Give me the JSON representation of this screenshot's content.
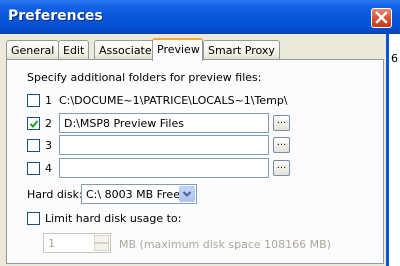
{
  "dialog": {
    "title": "Preferences"
  },
  "tabs": [
    "General",
    "Edit",
    "Associate",
    "Preview",
    "Smart Proxy"
  ],
  "active_tab": "Preview",
  "preview": {
    "intro": "Specify additional folders for preview files:",
    "folders": [
      {
        "index": "1",
        "checked": false,
        "path": "C:\\DOCUME~1\\PATRICE\\LOCALS~1\\Temp\\"
      },
      {
        "index": "2",
        "checked": true,
        "path": "D:\\MSP8 Preview Files",
        "browse": "..."
      },
      {
        "index": "3",
        "checked": false,
        "path": "",
        "browse": "..."
      },
      {
        "index": "4",
        "checked": false,
        "path": "",
        "browse": "..."
      }
    ],
    "hard_disk_label": "Hard disk:",
    "hard_disk_value": "C:\\ 8003 MB Free",
    "limit_label": "Limit hard disk usage to:",
    "limit_checked": false,
    "limit_value": "1",
    "limit_suffix": "MB (maximum disk space 108166 MB)"
  },
  "edge_text": "6",
  "colors": {
    "titlebar": "#0a57dc",
    "dialog_bg": "#ece9d8",
    "active_tab_accent": "#f5a73d",
    "close_button": "#d6502c"
  }
}
